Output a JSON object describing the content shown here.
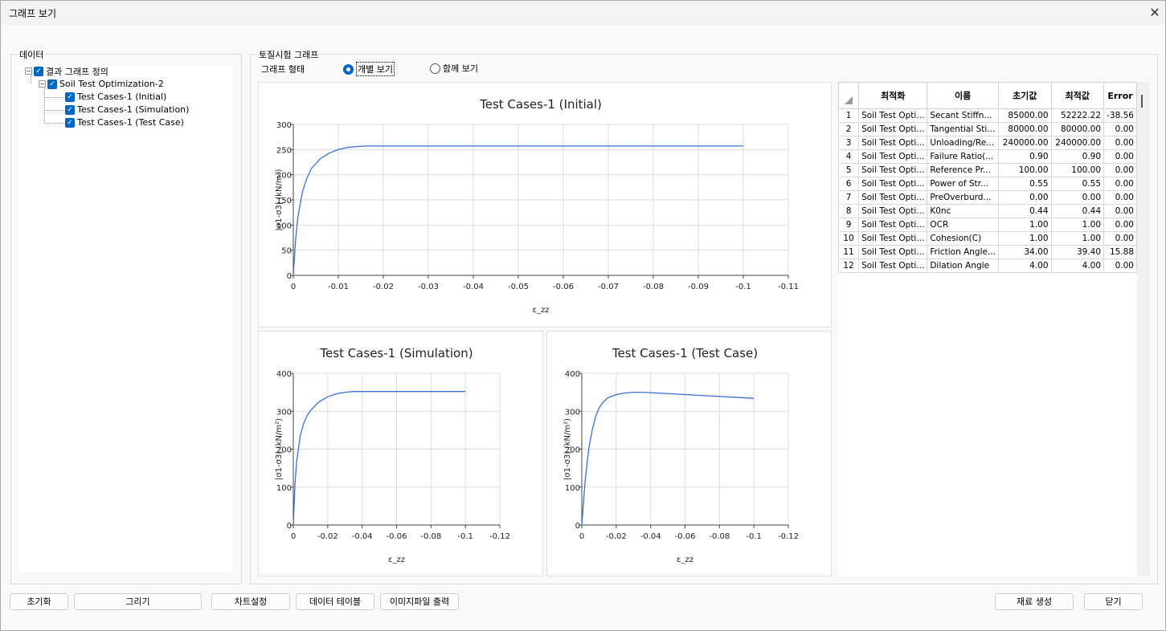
{
  "window": {
    "title": "그래프 보기",
    "close_glyph": "✕"
  },
  "data_panel": {
    "legend": "데이터",
    "tree": [
      {
        "label": "결과 그래프 정의",
        "checked": true,
        "level": 0
      },
      {
        "label": "Soil Test Optimization-2",
        "checked": true,
        "level": 1
      },
      {
        "label": "Test Cases-1 (Initial)",
        "checked": true,
        "level": 2
      },
      {
        "label": "Test Cases-1 (Simulation)",
        "checked": true,
        "level": 2
      },
      {
        "label": "Test Cases-1 (Test Case)",
        "checked": true,
        "level": 2
      }
    ]
  },
  "graph_panel": {
    "legend": "토질시험 그래프",
    "graph_type_label": "그래프 형태",
    "options": [
      {
        "label": "개별 보기",
        "selected": true
      },
      {
        "label": "함께 보기",
        "selected": false
      }
    ]
  },
  "chart_data": [
    {
      "type": "line",
      "title": "Test Cases-1 (Initial)",
      "xlabel": "ε_zz",
      "ylabel": "|σ1-σ3| (kN/m²)",
      "xlim": [
        0,
        -0.11
      ],
      "ylim": [
        0,
        300
      ],
      "xticks": [
        "0",
        "-0.01",
        "-0.02",
        "-0.03",
        "-0.04",
        "-0.05",
        "-0.06",
        "-0.07",
        "-0.08",
        "-0.09",
        "-0.1",
        "-0.11"
      ],
      "yticks": [
        "0",
        "50",
        "100",
        "150",
        "200",
        "250",
        "300"
      ],
      "series": [
        {
          "color": "#3a6fd8",
          "x": [
            0,
            -0.0005,
            -0.001,
            -0.002,
            -0.003,
            -0.004,
            -0.006,
            -0.008,
            -0.01,
            -0.012,
            -0.014,
            -0.016,
            -0.1
          ],
          "y": [
            0,
            70,
            115,
            165,
            193,
            212,
            232,
            243,
            250,
            254,
            256,
            257,
            257
          ]
        }
      ]
    },
    {
      "type": "line",
      "title": "Test Cases-1 (Simulation)",
      "xlabel": "ε_zz",
      "ylabel": "|σ1-σ3| (kN/m²)",
      "xlim": [
        0,
        -0.12
      ],
      "ylim": [
        0,
        400
      ],
      "xticks": [
        "0",
        "-0.02",
        "-0.04",
        "-0.06",
        "-0.08",
        "-0.1",
        "-0.12"
      ],
      "yticks": [
        "0",
        "100",
        "200",
        "300",
        "400"
      ],
      "series": [
        {
          "color": "#3a6fd8",
          "x": [
            0,
            -0.001,
            -0.002,
            -0.004,
            -0.006,
            -0.008,
            -0.01,
            -0.015,
            -0.02,
            -0.025,
            -0.03,
            -0.035,
            -0.1
          ],
          "y": [
            0,
            110,
            170,
            235,
            268,
            288,
            302,
            325,
            338,
            346,
            350,
            352,
            352
          ]
        }
      ]
    },
    {
      "type": "line",
      "title": "Test Cases-1 (Test Case)",
      "xlabel": "ε_zz",
      "ylabel": "|σ1-σ3| (kN/m²)",
      "xlim": [
        0,
        -0.12
      ],
      "ylim": [
        0,
        400
      ],
      "xticks": [
        "0",
        "-0.02",
        "-0.04",
        "-0.06",
        "-0.08",
        "-0.1",
        "-0.12"
      ],
      "yticks": [
        "0",
        "100",
        "200",
        "300",
        "400"
      ],
      "series": [
        {
          "color": "#3a6fd8",
          "x": [
            0,
            -0.002,
            -0.004,
            -0.006,
            -0.008,
            -0.01,
            -0.012,
            -0.015,
            -0.02,
            -0.025,
            -0.03,
            -0.035,
            -0.04,
            -0.06,
            -0.08,
            -0.1
          ],
          "y": [
            0,
            120,
            200,
            250,
            285,
            308,
            322,
            335,
            344,
            348,
            350,
            350,
            349,
            344,
            339,
            334
          ]
        }
      ]
    }
  ],
  "table": {
    "headers": [
      "",
      "최적화",
      "이름",
      "초기값",
      "최적값",
      "Error"
    ],
    "rows": [
      [
        "1",
        "Soil Test Opti...",
        "Secant Stiffn...",
        "85000.00",
        "52222.22",
        "-38.56"
      ],
      [
        "2",
        "Soil Test Opti...",
        "Tangential Sti...",
        "80000.00",
        "80000.00",
        "0.00"
      ],
      [
        "3",
        "Soil Test Opti...",
        "Unloading/Re...",
        "240000.00",
        "240000.00",
        "0.00"
      ],
      [
        "4",
        "Soil Test Opti...",
        "Failure Ratio(...",
        "0.90",
        "0.90",
        "0.00"
      ],
      [
        "5",
        "Soil Test Opti...",
        "Reference Pr...",
        "100.00",
        "100.00",
        "0.00"
      ],
      [
        "6",
        "Soil Test Opti...",
        "Power of Str...",
        "0.55",
        "0.55",
        "0.00"
      ],
      [
        "7",
        "Soil Test Opti...",
        "PreOverburd...",
        "0.00",
        "0.00",
        "0.00"
      ],
      [
        "8",
        "Soil Test Opti...",
        "K0nc",
        "0.44",
        "0.44",
        "0.00"
      ],
      [
        "9",
        "Soil Test Opti...",
        "OCR",
        "1.00",
        "1.00",
        "0.00"
      ],
      [
        "10",
        "Soil Test Opti...",
        "Cohesion(C)",
        "1.00",
        "1.00",
        "0.00"
      ],
      [
        "11",
        "Soil Test Opti...",
        "Friction Angle...",
        "34.00",
        "39.40",
        "15.88"
      ],
      [
        "12",
        "Soil Test Opti...",
        "Dilation Angle",
        "4.00",
        "4.00",
        "0.00"
      ]
    ]
  },
  "buttons": {
    "reset": "초기화",
    "draw": "그리기",
    "chart_settings": "차트설정",
    "data_table": "데이터 테이블",
    "image_export": "이미지파일 출력",
    "create_material": "재료 생성",
    "close": "닫기"
  }
}
